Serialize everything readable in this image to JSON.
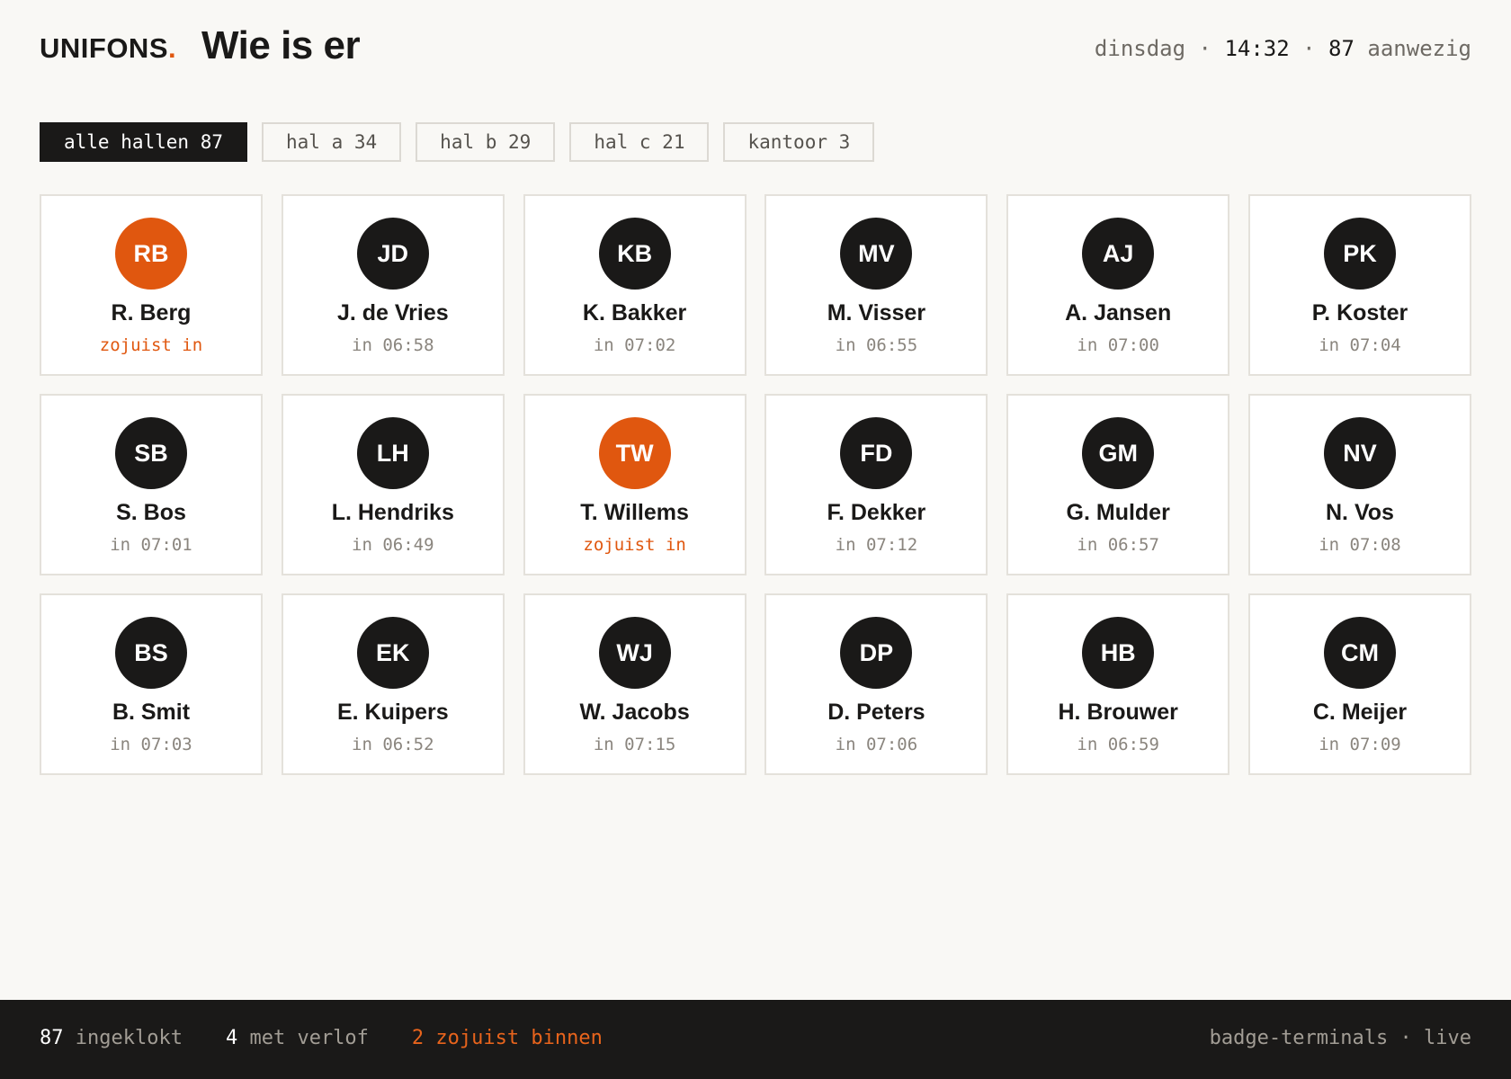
{
  "brand": {
    "name": "UNIFONS",
    "dot": "."
  },
  "header": {
    "title": "Wie is er",
    "day": "dinsdag",
    "sep": " · ",
    "time": "14:32",
    "present_count": "87",
    "present_label": "aanwezig"
  },
  "filters": [
    {
      "label": "alle hallen 87",
      "active": true
    },
    {
      "label": "hal a 34",
      "active": false
    },
    {
      "label": "hal b 29",
      "active": false
    },
    {
      "label": "hal c 21",
      "active": false
    },
    {
      "label": "kantoor 3",
      "active": false
    }
  ],
  "people": [
    {
      "initials": "RB",
      "name": "R. Berg",
      "status": "zojuist in",
      "recent": true
    },
    {
      "initials": "JD",
      "name": "J. de Vries",
      "status": "in 06:58",
      "recent": false
    },
    {
      "initials": "KB",
      "name": "K. Bakker",
      "status": "in 07:02",
      "recent": false
    },
    {
      "initials": "MV",
      "name": "M. Visser",
      "status": "in 06:55",
      "recent": false
    },
    {
      "initials": "AJ",
      "name": "A. Jansen",
      "status": "in 07:00",
      "recent": false
    },
    {
      "initials": "PK",
      "name": "P. Koster",
      "status": "in 07:04",
      "recent": false
    },
    {
      "initials": "SB",
      "name": "S. Bos",
      "status": "in 07:01",
      "recent": false
    },
    {
      "initials": "LH",
      "name": "L. Hendriks",
      "status": "in 06:49",
      "recent": false
    },
    {
      "initials": "TW",
      "name": "T. Willems",
      "status": "zojuist in",
      "recent": true
    },
    {
      "initials": "FD",
      "name": "F. Dekker",
      "status": "in 07:12",
      "recent": false
    },
    {
      "initials": "GM",
      "name": "G. Mulder",
      "status": "in 06:57",
      "recent": false
    },
    {
      "initials": "NV",
      "name": "N. Vos",
      "status": "in 07:08",
      "recent": false
    },
    {
      "initials": "BS",
      "name": "B. Smit",
      "status": "in 07:03",
      "recent": false
    },
    {
      "initials": "EK",
      "name": "E. Kuipers",
      "status": "in 06:52",
      "recent": false
    },
    {
      "initials": "WJ",
      "name": "W. Jacobs",
      "status": "in 07:15",
      "recent": false
    },
    {
      "initials": "DP",
      "name": "D. Peters",
      "status": "in 07:06",
      "recent": false
    },
    {
      "initials": "HB",
      "name": "H. Brouwer",
      "status": "in 06:59",
      "recent": false
    },
    {
      "initials": "CM",
      "name": "C. Meijer",
      "status": "in 07:09",
      "recent": false
    }
  ],
  "footer": {
    "clocked_in_count": "87",
    "clocked_in_label": "ingeklokt",
    "leave_count": "4",
    "leave_label": "met verlof",
    "recent_label": "2 zojuist binnen",
    "source": "badge-terminals · live"
  },
  "colors": {
    "accent": "#e0570f",
    "dark": "#1a1918",
    "background": "#f9f8f5"
  }
}
